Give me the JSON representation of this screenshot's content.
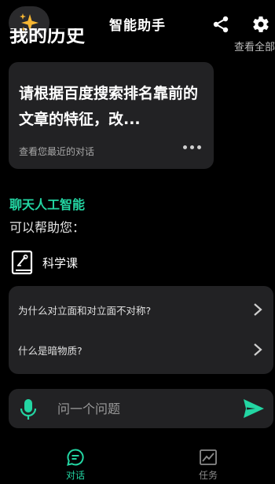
{
  "header": {
    "title": "智能助手"
  },
  "history": {
    "heading": "我的历史",
    "view_all": "查看全部",
    "card": {
      "text": "请根据百度搜索排名靠前的文章的特征，改...",
      "subtitle": "查看您最近的对话"
    }
  },
  "ai_section": {
    "title": "聊天人工智能",
    "subtitle": "可以帮助您：",
    "topic": {
      "label": "科学课",
      "icon": "book-icon"
    }
  },
  "suggestions": [
    {
      "text": "为什么对立面和对立面不对称?"
    },
    {
      "text": "什么是暗物质?"
    }
  ],
  "input": {
    "placeholder": "问一个问题"
  },
  "bottom_nav": [
    {
      "label": "对话",
      "icon": "chat-icon",
      "active": true
    },
    {
      "label": "任务",
      "icon": "chart-icon",
      "active": false
    }
  ],
  "colors": {
    "accent": "#23d6a3",
    "card": "#222224",
    "background": "#000000"
  }
}
